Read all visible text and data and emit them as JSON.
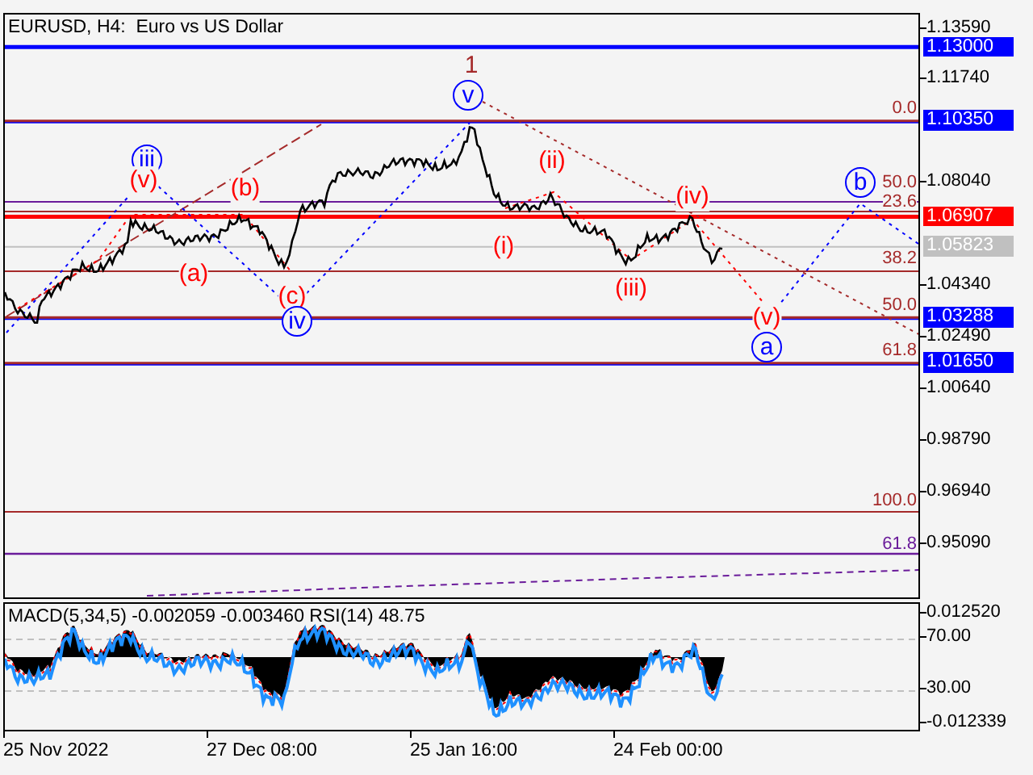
{
  "chart": {
    "title": "EURUSD, H4:  Euro vs US Dollar",
    "price_axis": [
      "1.13590",
      "1.11740",
      "1.08040",
      "1.04340",
      "1.02490",
      "1.00640",
      "0.98790",
      "0.96940",
      "0.95090"
    ],
    "price_tags": [
      {
        "text": "1.13000",
        "color": "#0000ff"
      },
      {
        "text": "1.10350",
        "color": "#0000ff"
      },
      {
        "text": "1.06907",
        "color": "#ff0000"
      },
      {
        "text": "1.05823",
        "color": "#c0c0c0"
      },
      {
        "text": "1.03288",
        "color": "#0000ff"
      },
      {
        "text": "1.01650",
        "color": "#0000ff"
      }
    ],
    "fib_labels": [
      {
        "text": "0.0",
        "color": "#a52a2a"
      },
      {
        "text": "50.0",
        "color": "#a52a2a"
      },
      {
        "text": "23.6",
        "color": "#a52a2a"
      },
      {
        "text": "38.2",
        "color": "#a52a2a"
      },
      {
        "text": "50.0",
        "color": "#a52a2a"
      },
      {
        "text": "61.8",
        "color": "#a52a2a"
      },
      {
        "text": "100.0",
        "color": "#a52a2a"
      },
      {
        "text": "61.8",
        "color": "#6a1b9a"
      }
    ],
    "wave_labels": [
      {
        "text": "1",
        "color": "#a52a2a",
        "circled": false
      },
      {
        "text": "v",
        "color": "#0000ff",
        "circled": true
      },
      {
        "text": "iii",
        "color": "#0000ff",
        "circled": true
      },
      {
        "text": "(v)",
        "color": "#ff0000",
        "circled": false
      },
      {
        "text": "(b)",
        "color": "#ff0000",
        "circled": false
      },
      {
        "text": "(a)",
        "color": "#ff0000",
        "circled": false
      },
      {
        "text": "(c)",
        "color": "#ff0000",
        "circled": false
      },
      {
        "text": "iv",
        "color": "#0000ff",
        "circled": true
      },
      {
        "text": "(i)",
        "color": "#ff0000",
        "circled": false
      },
      {
        "text": "(ii)",
        "color": "#ff0000",
        "circled": false
      },
      {
        "text": "(iii)",
        "color": "#ff0000",
        "circled": false
      },
      {
        "text": "(iv)",
        "color": "#ff0000",
        "circled": false
      },
      {
        "text": "(v)",
        "color": "#ff0000",
        "circled": false
      },
      {
        "text": "a",
        "color": "#0000ff",
        "circled": true
      },
      {
        "text": "b",
        "color": "#0000ff",
        "circled": true
      }
    ]
  },
  "indicator": {
    "legend": "MACD(5,34,5) -0.002059 -0.003460 RSI(14) 48.75",
    "axis": [
      "0.012520",
      "70.00",
      "30.00",
      "-0.012339"
    ]
  },
  "time_axis": [
    "25 Nov 2022",
    "27 Dec 08:00",
    "25 Jan 16:00",
    "24 Feb 00:00"
  ]
}
